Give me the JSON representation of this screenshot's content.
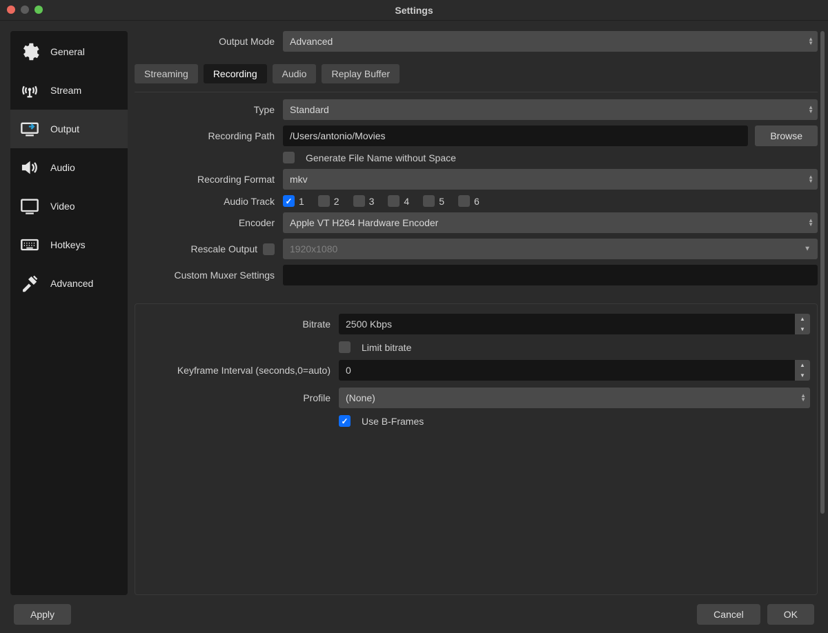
{
  "window": {
    "title": "Settings"
  },
  "sidebar": {
    "items": [
      {
        "label": "General"
      },
      {
        "label": "Stream"
      },
      {
        "label": "Output"
      },
      {
        "label": "Audio"
      },
      {
        "label": "Video"
      },
      {
        "label": "Hotkeys"
      },
      {
        "label": "Advanced"
      }
    ]
  },
  "output": {
    "mode_label": "Output Mode",
    "mode_value": "Advanced",
    "tabs": [
      "Streaming",
      "Recording",
      "Audio",
      "Replay Buffer"
    ],
    "type_label": "Type",
    "type_value": "Standard",
    "path_label": "Recording Path",
    "path_value": "/Users/antonio/Movies",
    "browse_label": "Browse",
    "gen_filename_label": "Generate File Name without Space",
    "format_label": "Recording Format",
    "format_value": "mkv",
    "audio_track_label": "Audio Track",
    "audio_tracks": [
      "1",
      "2",
      "3",
      "4",
      "5",
      "6"
    ],
    "encoder_label": "Encoder",
    "encoder_value": "Apple VT H264 Hardware Encoder",
    "rescale_label": "Rescale Output",
    "rescale_value": "1920x1080",
    "muxer_label": "Custom Muxer Settings",
    "muxer_value": ""
  },
  "encoder_settings": {
    "bitrate_label": "Bitrate",
    "bitrate_value": "2500 Kbps",
    "limit_label": "Limit bitrate",
    "keyframe_label": "Keyframe Interval (seconds,0=auto)",
    "keyframe_value": "0",
    "profile_label": "Profile",
    "profile_value": "(None)",
    "bframes_label": "Use B-Frames"
  },
  "footer": {
    "apply": "Apply",
    "cancel": "Cancel",
    "ok": "OK"
  }
}
